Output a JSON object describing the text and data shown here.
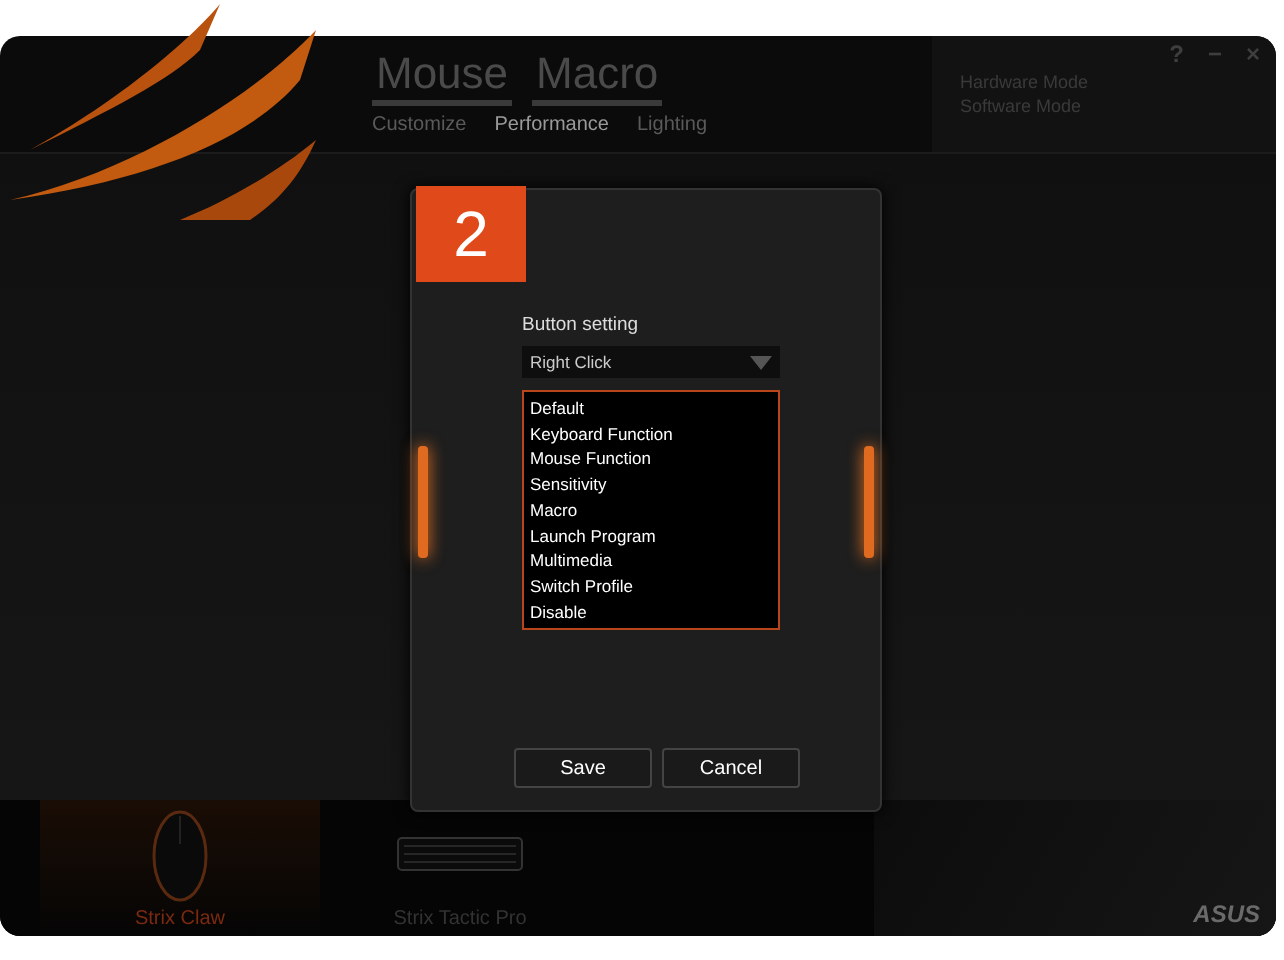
{
  "main_tabs": [
    {
      "label": "Mouse"
    },
    {
      "label": "Macro"
    }
  ],
  "sub_tabs": [
    {
      "label": "Customize",
      "selected": false
    },
    {
      "label": "Performance",
      "selected": true
    },
    {
      "label": "Lighting",
      "selected": false
    }
  ],
  "window_controls": [
    "?",
    "−",
    "×"
  ],
  "modes": [
    "Hardware Mode",
    "Software Mode"
  ],
  "dialog": {
    "badge": "2",
    "label": "Button setting",
    "dropdown": {
      "value": "Right Click"
    },
    "options": [
      "Default",
      "Keyboard Function",
      "Mouse Function",
      "Sensitivity",
      "Macro",
      "Launch Program",
      "Multimedia",
      "Switch Profile",
      "Disable"
    ],
    "buttons": [
      "Save",
      "Cancel"
    ]
  },
  "devices": [
    {
      "name": "Strix Claw",
      "kind": "mouse",
      "selected": true
    },
    {
      "name": "Strix Tactic Pro",
      "kind": "keyboard",
      "selected": false
    }
  ],
  "logo": "ASUS"
}
